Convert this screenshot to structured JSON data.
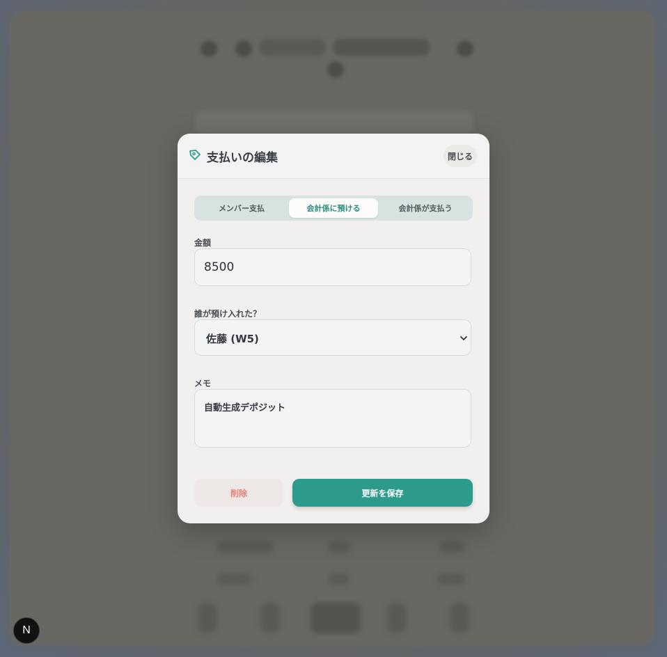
{
  "modal": {
    "title": "支払いの編集",
    "close_label": "閉じる",
    "tabs": [
      {
        "label": "メンバー支払",
        "active": false
      },
      {
        "label": "会計係に預ける",
        "active": true
      },
      {
        "label": "会計係が支払う",
        "active": false
      }
    ],
    "amount": {
      "label": "金額",
      "value": "8500"
    },
    "depositor": {
      "label": "誰が預け入れた？",
      "selected": "佐藤 (W5)"
    },
    "memo": {
      "label": "メモ",
      "value": "自動生成デポジット"
    },
    "delete_label": "削除",
    "save_label": "更新を保存"
  },
  "badge": {
    "letter": "N"
  },
  "colors": {
    "accent": "#2d9b8c",
    "danger": "#e5837b",
    "tab_bg": "#d6e3e1"
  }
}
